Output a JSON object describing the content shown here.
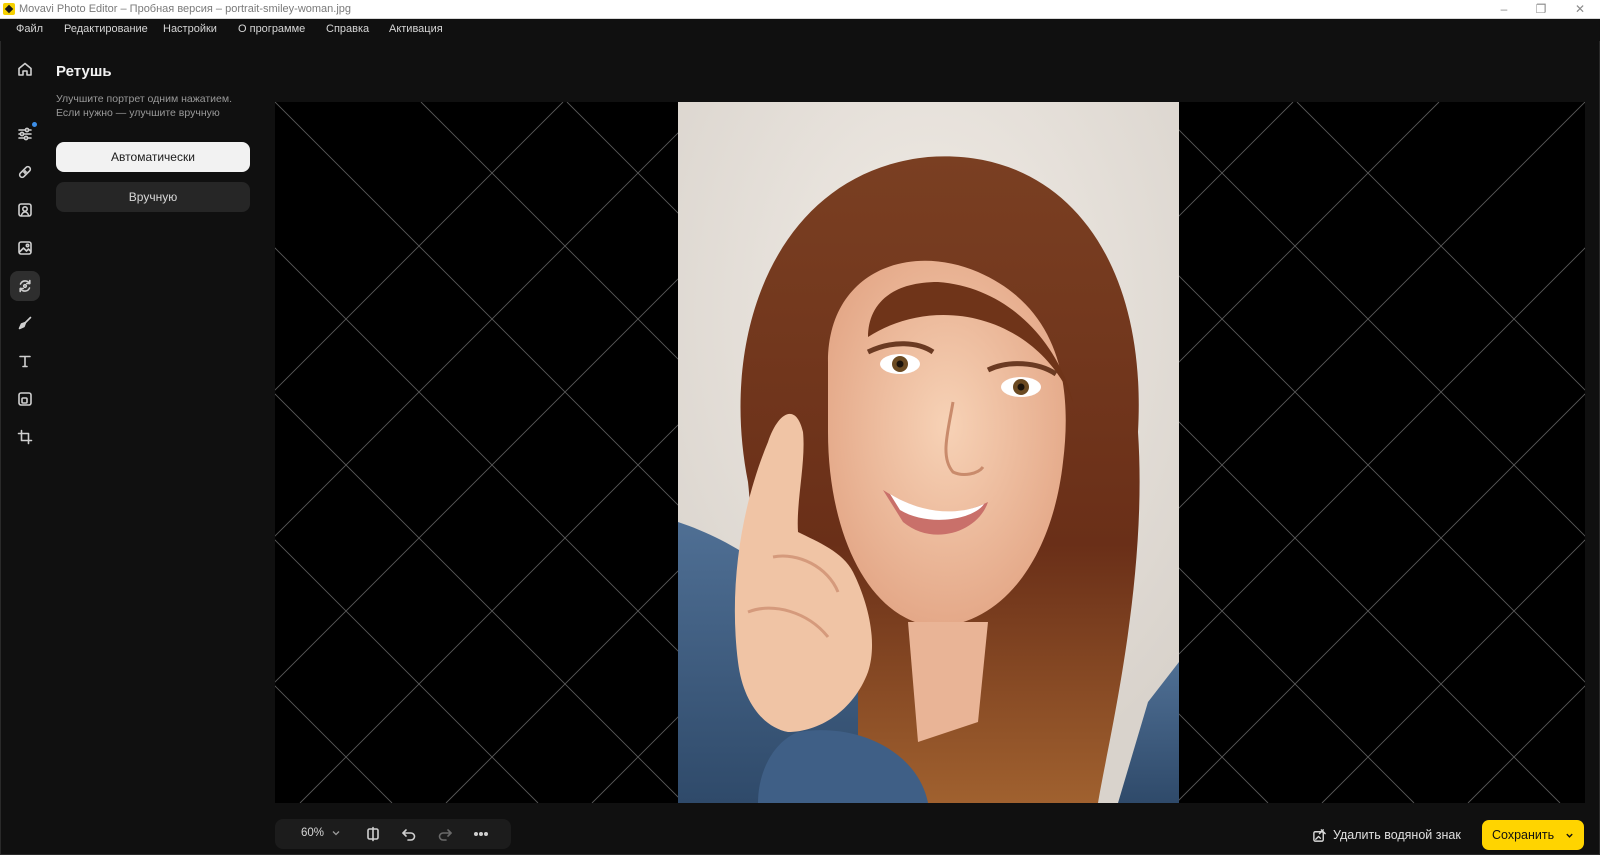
{
  "window": {
    "title": "Movavi Photo Editor – Пробная версия – portrait-smiley-woman.jpg",
    "controls": [
      "–",
      "❐",
      "✕"
    ]
  },
  "menu": [
    "Файл",
    "Редактирование",
    "Настройки",
    "О программе",
    "Справка",
    "Активация"
  ],
  "tools": [
    {
      "icon": "home-icon"
    },
    {
      "icon": "adjust-sliders-icon",
      "badge": true
    },
    {
      "icon": "bandage-icon"
    },
    {
      "icon": "portrait-icon"
    },
    {
      "icon": "image-enhance-icon"
    },
    {
      "icon": "retouch-icon",
      "active": true
    },
    {
      "icon": "brush-icon"
    },
    {
      "icon": "text-icon"
    },
    {
      "icon": "frame-icon"
    },
    {
      "icon": "crop-icon"
    }
  ],
  "panel": {
    "title": "Ретушь",
    "description_line1": "Улучшите портрет одним нажатием.",
    "description_line2": "Если нужно — улучшите вручную",
    "auto_label": "Автоматически",
    "manual_label": "Вручную"
  },
  "bottom": {
    "zoom": "60%",
    "remove_watermark": "Удалить водяной знак",
    "save": "Сохранить"
  },
  "colors": {
    "accent": "#ffd400",
    "badge": "#3d8fe8"
  }
}
